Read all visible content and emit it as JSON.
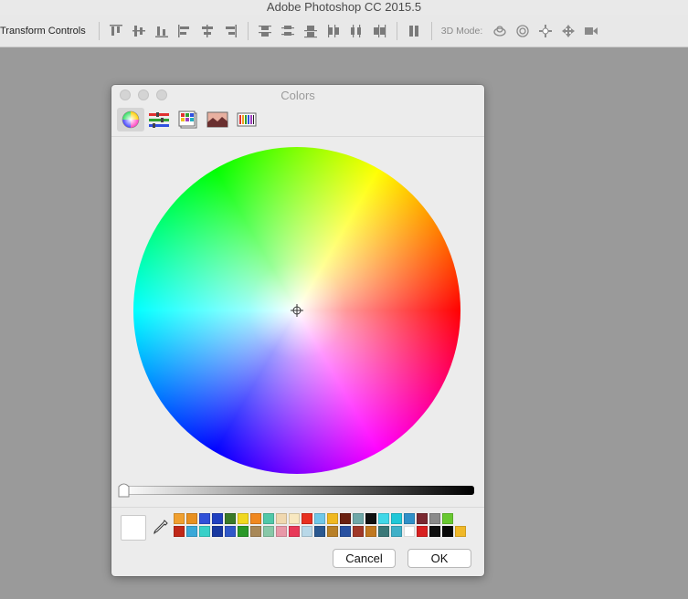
{
  "app": {
    "title": "Adobe Photoshop CC 2015.5"
  },
  "options_bar": {
    "transform_label": "Transform Controls",
    "mode_label": "3D Mode:",
    "align_buttons": [
      {
        "name": "align-top-edges-icon"
      },
      {
        "name": "align-vertical-centers-icon"
      },
      {
        "name": "align-bottom-edges-icon"
      },
      {
        "name": "align-left-edges-icon"
      },
      {
        "name": "align-horizontal-centers-icon"
      },
      {
        "name": "align-right-edges-icon"
      }
    ],
    "distribute_buttons": [
      {
        "name": "distribute-top-edges-icon"
      },
      {
        "name": "distribute-vertical-centers-icon"
      },
      {
        "name": "distribute-bottom-edges-icon"
      },
      {
        "name": "distribute-left-edges-icon"
      },
      {
        "name": "distribute-horizontal-centers-icon"
      },
      {
        "name": "distribute-right-edges-icon"
      }
    ],
    "auto_align": {
      "name": "auto-align-layers-icon"
    },
    "mode_buttons": [
      {
        "name": "3d-orbit-icon"
      },
      {
        "name": "3d-roll-icon"
      },
      {
        "name": "3d-pan-icon"
      },
      {
        "name": "3d-slide-icon"
      },
      {
        "name": "3d-scale-icon"
      }
    ]
  },
  "colors_panel": {
    "title": "Colors",
    "tabs": [
      {
        "name": "color-wheel-tab",
        "icon": "color-wheel-icon",
        "active": true
      },
      {
        "name": "color-sliders-tab",
        "icon": "color-sliders-icon",
        "active": false
      },
      {
        "name": "color-palettes-tab",
        "icon": "color-palettes-icon",
        "active": false
      },
      {
        "name": "image-palettes-tab",
        "icon": "image-palettes-icon",
        "active": false
      },
      {
        "name": "pencils-tab",
        "icon": "pencils-icon",
        "active": false
      }
    ],
    "current_color": "#ffffff",
    "swatches": [
      [
        "#f0a030",
        "#e89020",
        "#3050d8",
        "#2040c0",
        "#3a7a28",
        "#f0d820",
        "#f08820",
        "#50c8a8",
        "#f0d8b0",
        "#f8e8c0",
        "#e83020",
        "#70c8e8",
        "#f0b820",
        "#6a2010",
        "#70a8a8",
        "#101010",
        "#40d8e8",
        "#20c8d8",
        "#3090c8",
        "#7a2830",
        "#8a8a8a",
        "#68c830"
      ],
      [
        "#c02818",
        "#3aa8d8",
        "#38d0c8",
        "#1838a0",
        "#3058c8",
        "#2a9828",
        "#a88858",
        "#88c8a8",
        "#e898a8",
        "#e83858",
        "#b8d8e8",
        "#2a5890",
        "#b88028",
        "#2850a0",
        "#a03828",
        "#c07820",
        "#3a7878",
        "#40b0c8",
        "#ffffff",
        "#d82020",
        "#101010",
        "#080808",
        "#f0b828"
      ]
    ],
    "buttons": {
      "cancel": "Cancel",
      "ok": "OK"
    }
  }
}
